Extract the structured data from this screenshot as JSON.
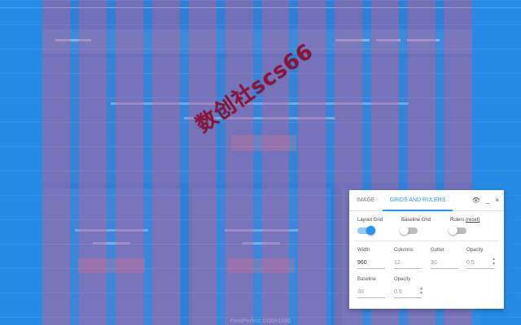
{
  "watermark": "数创社scs66",
  "footer": "PixelPerfect 1920×1080",
  "panel": {
    "tabs": [
      {
        "label": "IMAGE",
        "active": false
      },
      {
        "label": "GRIDS AND RULERS",
        "active": true
      }
    ],
    "actions": {
      "visibility": "👁",
      "minimize": "_",
      "close": "×"
    },
    "toggles": {
      "layout_grid": {
        "label": "Layout Grid",
        "on": true
      },
      "baseline_grid": {
        "label": "Baseline Grid",
        "on": false
      },
      "rulers": {
        "label": "Rulers",
        "reset": "(reset)",
        "on": false
      }
    },
    "fields": {
      "width": {
        "label": "Width",
        "value": "960"
      },
      "columns": {
        "label": "Columns",
        "value": "12"
      },
      "gutter": {
        "label": "Gutter",
        "value": "30"
      },
      "opacity1": {
        "label": "Opacity",
        "value": "0.5"
      },
      "baseline": {
        "label": "Baseline",
        "value": "30"
      },
      "opacity2": {
        "label": "Opacity",
        "value": "0.5"
      }
    }
  },
  "colors": {
    "accent": "#2196f3",
    "grid_column": "#dc5a8c",
    "watermark": "#8b1538"
  }
}
